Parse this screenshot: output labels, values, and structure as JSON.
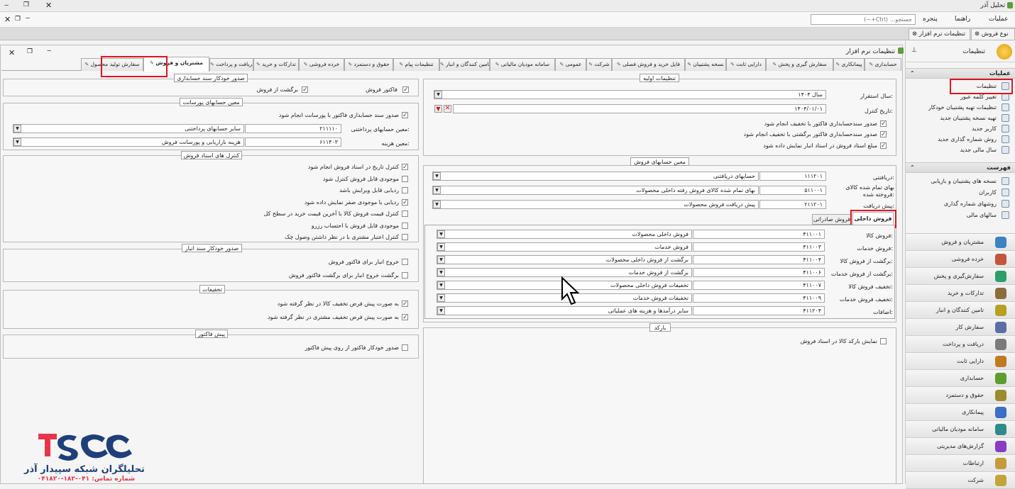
{
  "window": {
    "title": "تحلیل آذر"
  },
  "menu": {
    "search_placeholder": "جستجو... (Ctrl+~)",
    "items": [
      "عملیات",
      "راهنما",
      "پنجره"
    ]
  },
  "doc_tabs": [
    "نوع فروش",
    "تنظیمات نرم افزار"
  ],
  "sidebar": {
    "title": "تنظیمات",
    "ops_title": "عملیات",
    "ops": [
      "تنظیمات",
      "تغییر کلمه عبور",
      "تنظیمات تهیه پشتیبان خودکار",
      "تهیه نسخه پشتیبان جدید",
      "کاربر جدید",
      "روش شماره گذاری جدید",
      "سال مالی جدید"
    ],
    "list_title": "فهرست",
    "list": [
      "نسخه های پشتیبان و بازیابی",
      "کاربران",
      "روشهای شماره گذاری",
      "سالهای مالی"
    ],
    "nav": [
      "مشتریان و فروش",
      "خرده فروشی",
      "سفارش‌گیری و پخش",
      "تدارکات و خرید",
      "تامین کنندگان و انبار",
      "سفارش کار",
      "دریافت و پرداخت",
      "دارایی ثابت",
      "حسابداری",
      "حقوق و دستمزد",
      "پیمانکاری",
      "سامانه مودیان مالیاتی",
      "گزارش‌های مدیریتی",
      "ارتباطات",
      "شرکت"
    ]
  },
  "panel": {
    "title": "تنظیمات نرم افزار"
  },
  "tabs": [
    "حسابداری",
    "پیمانکاری",
    "سفارش گیری و پخش",
    "دارایی ثابت",
    "نسخه پشتیبان",
    "فایل خرید و فروش فصلی",
    "شرکت",
    "عمومی",
    "سامانه مودیان مالیاتی",
    "تامین کنندگان و انبار",
    "تنظیمات پیام",
    "حقوق و دستمزد",
    "خرده فروشی",
    "تدارکات و خرید",
    "دریافت و پرداخت",
    "مشتریان و فروش",
    "سفارش تولید محصول"
  ],
  "initial": {
    "title": "تنظیمات اولیه",
    "year_label": "سال استقرار:",
    "year_value": "سال ۱۴۰۴",
    "control_label": "تاریخ کنترل:",
    "control_value": "۱۴۰۴/۰۱/۰۱",
    "checks": [
      "صدور سندحسابداری فاکتور با تخفیف انجام شود",
      "صدور سندحسابداری فاکتور برگشتی با تخفیف انجام شود",
      "مبلغ اسناد فروش در اسناد انبار نمایش داده شود"
    ]
  },
  "sales_accounts": {
    "title": "معین حسابهای فروش",
    "rows": [
      {
        "label": "دریافتنی:",
        "code": "۱۱۱۲۰۱",
        "name": "حسابهای دریافتنی"
      },
      {
        "label": "بهای تمام شده کالای فروخته شده:",
        "code": "۵۱۱۰۰۱",
        "name": "بهای تمام شده کالای فروش رفته داخلی محصولات"
      },
      {
        "label": "پیش دریافت:",
        "code": "۲۱۱۲۰۱",
        "name": "پیش دریافت فروش محصولات"
      }
    ]
  },
  "sales_tabs": {
    "domestic": "فروش داخلی",
    "export": "فروش صادراتی"
  },
  "domestic_rows": [
    {
      "label": "فروش کالا:",
      "code": "۴۱۱۰۰۱",
      "name": "فروش داخلی محصولات"
    },
    {
      "label": "فروش خدمات:",
      "code": "۴۱۱۰۰۳",
      "name": "فروش خدمات"
    },
    {
      "label": "برگشت از فروش کالا:",
      "code": "۴۱۱۰۰۴",
      "name": "برگشت از فروش داخلی محصولات"
    },
    {
      "label": "برگشت از فروش خدمات:",
      "code": "۴۱۱۰۰۶",
      "name": "برگشت از فروش خدمات"
    },
    {
      "label": "تخفیف فروش کالا:",
      "code": "۴۱۱۰۰۷",
      "name": "تخفیفات فروش داخلی محصولات"
    },
    {
      "label": "تخفیف فروش خدمات:",
      "code": "۴۱۱۰۰۹",
      "name": "تخفیفات فروش خدمات"
    },
    {
      "label": "اضافات:",
      "code": "۴۱۱۲۰۴",
      "name": "سایر درآمدها و هزینه های عملیاتی"
    }
  ],
  "barcode": {
    "title": "بارکد",
    "check": "نمایش بارکد کالا در اسناد فروش"
  },
  "auto_doc": {
    "title": "صدور خودکار سند حسابداری",
    "invoice": "فاکتور فروش",
    "return": "برگشت از فروش"
  },
  "commission": {
    "title": "معین حسابهای پورسانت",
    "check": "صدور سند حسابداری فاکتور با پورسانت انجام شود",
    "payable_label": "معین حسابهای پرداختنی:",
    "payable_code": "۲۱۱۱۱۰",
    "payable_name": "سایر حسابهای پرداختنی",
    "expense_label": "معین هزینه:",
    "expense_code": "۶۱۱۴۰۳",
    "expense_name": "هزینه بازاریابی و پورسانت فروش"
  },
  "doc_control": {
    "title": "کنترل های اسناد فروش",
    "checks": [
      {
        "text": "کنترل تاریخ در اسناد فروش انجام شود",
        "on": true
      },
      {
        "text": "موجودی قابل فروش کنترل شود",
        "on": false
      },
      {
        "text": "ردیابی قابل ویرایش باشد",
        "on": false
      },
      {
        "text": "ردیابی با موجودی صفر نمایش داده شود",
        "on": true
      },
      {
        "text": "کنترل قیمت فروش کالا با آخرین قیمت خرید در سطح کل",
        "on": false
      },
      {
        "text": "موجودی قابل فروش با احتساب رزرو",
        "on": false
      },
      {
        "text": "کنترل اعتبار مشتری با در نظر داشتن وصول چک",
        "on": false
      }
    ]
  },
  "auto_stock": {
    "title": "صدور خودکار سند انبار",
    "checks": [
      "خروج انبار برای فاکتور فروش",
      "برگشت خروج انبار برای برگشت فاکتور فروش"
    ]
  },
  "discounts": {
    "title": "تخفیفات",
    "checks": [
      "به صورت پیش فرض تخفیف کالا در نظر گرفته شود",
      "به صورت پیش فرض تخفیف مشتری در نظر گرفته شود"
    ]
  },
  "preinvoice": {
    "title": "پیش فاکتور",
    "check": "صدور خودکار فاکتور از روی پیش فاکتور"
  },
  "brand": {
    "name": "تحلیلگران شبکه سپیدار آذر",
    "sub": "شماره تماس: ۰۴۱-۱۸۲-۰۴۱۸۲۰"
  },
  "colors": {
    "highlight": "#e0151d",
    "brand_red": "#e8344a",
    "brand_navy": "#1f3f7a"
  }
}
